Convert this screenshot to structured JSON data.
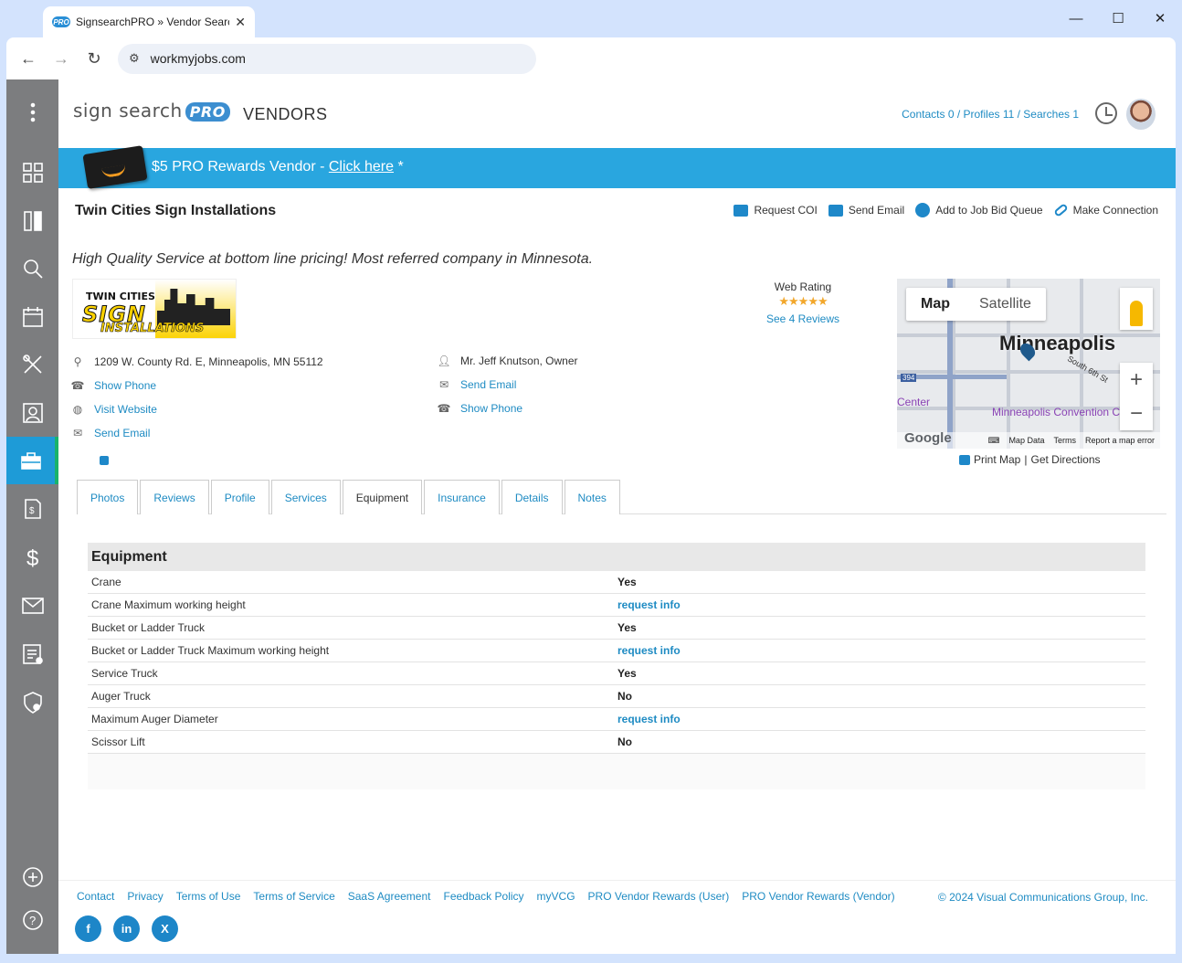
{
  "browser": {
    "tab_title": "SignsearchPRO » Vendor Search",
    "tab_icon_text": "PRO",
    "url": "workmyjobs.com"
  },
  "header": {
    "logo_text": "sign search",
    "logo_pro": "PRO",
    "page_heading": "VENDORS",
    "counts": "Contacts 0 / Profiles 11 / Searches 1"
  },
  "banner": {
    "text": "$5 PRO Rewards Vendor - ",
    "link": "Click here",
    "suffix": " *"
  },
  "vendor": {
    "name": "Twin Cities Sign Installations",
    "tagline": "High Quality Service at bottom line pricing! Most referred company in Minnesota.",
    "logo_line1": "TWIN CITIES",
    "logo_line2": "SIGN",
    "logo_line3": "INSTALLATIONS",
    "address": "1209 W. County Rd. E, Minneapolis, MN 55112",
    "show_phone": "Show Phone",
    "visit_website": "Visit Website",
    "send_email": "Send Email",
    "contact_name": "Mr. Jeff Knutson, Owner",
    "contact_email": "Send Email",
    "contact_phone": "Show Phone"
  },
  "actions": {
    "request_coi": "Request COI",
    "send_email": "Send Email",
    "add_bid_queue": "Add to Job Bid Queue",
    "make_connection": "Make Connection"
  },
  "rating": {
    "label": "Web Rating",
    "stars": "★★★★★",
    "value": 5,
    "reviews": "See 4 Reviews"
  },
  "map": {
    "map_label": "Map",
    "satellite_label": "Satellite",
    "city": "Minneapolis",
    "street": "South 6th St",
    "poi": "Minneapolis Convention Center",
    "center_label": "Center",
    "hwy": "394",
    "google": "Google",
    "map_data": "Map Data",
    "terms": "Terms",
    "report": "Report a map error",
    "zoom_in": "+",
    "zoom_out": "−",
    "print_map": "Print Map",
    "separator": "|",
    "get_directions": "Get Directions"
  },
  "tabs": [
    {
      "label": "Photos"
    },
    {
      "label": "Reviews"
    },
    {
      "label": "Profile"
    },
    {
      "label": "Services"
    },
    {
      "label": "Equipment",
      "active": true
    },
    {
      "label": "Insurance"
    },
    {
      "label": "Details"
    },
    {
      "label": "Notes"
    }
  ],
  "equipment": {
    "title": "Equipment",
    "rows": [
      {
        "label": "Crane",
        "value": "Yes"
      },
      {
        "label": "Crane Maximum working height",
        "value": "request info"
      },
      {
        "label": "Bucket or Ladder Truck",
        "value": "Yes"
      },
      {
        "label": "Bucket or Ladder Truck Maximum working height",
        "value": "request info"
      },
      {
        "label": "Service Truck",
        "value": "Yes"
      },
      {
        "label": "Auger Truck",
        "value": "No"
      },
      {
        "label": "Maximum Auger Diameter",
        "value": "request info"
      },
      {
        "label": "Scissor Lift",
        "value": "No"
      }
    ]
  },
  "footer": {
    "links": [
      "Contact",
      "Privacy",
      "Terms of Use",
      "Terms of Service",
      "SaaS Agreement",
      "Feedback Policy",
      "myVCG",
      "PRO Vendor Rewards (User)",
      "PRO Vendor Rewards (Vendor)"
    ],
    "copyright": "© 2024 Visual Communications Group, Inc.",
    "socials": [
      "f",
      "in",
      "X"
    ]
  },
  "colors": {
    "accent": "#1e8bc3",
    "banner": "#29a6df",
    "sidebar": "#7c7d7f",
    "sidebar_active": "#1e9bd7"
  }
}
